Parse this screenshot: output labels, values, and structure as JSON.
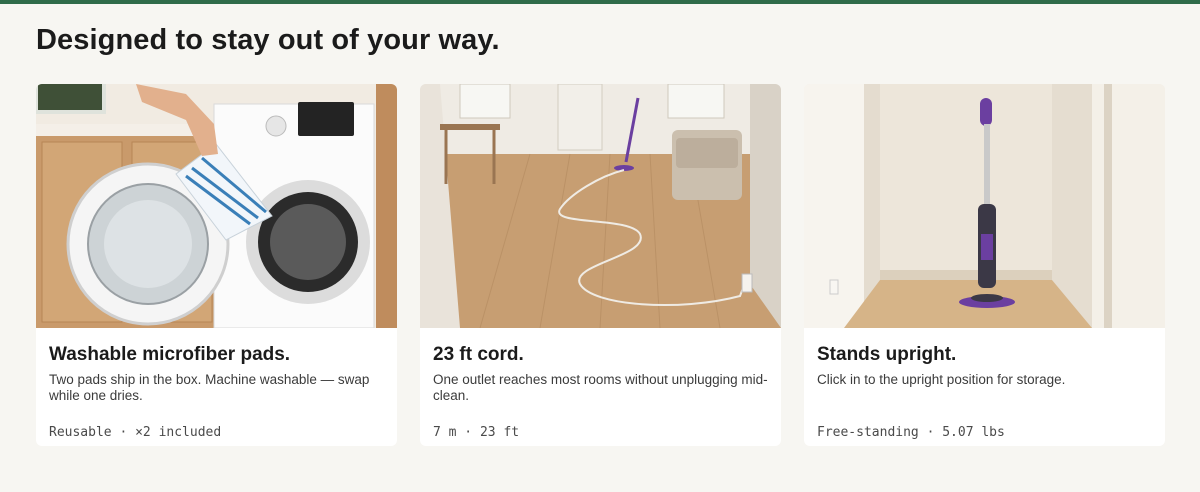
{
  "accent_color": "#2f6b4a",
  "section": {
    "headline": "Designed to stay out of your way."
  },
  "cards": [
    {
      "image_icon": "washing-machine-with-pad-photo",
      "title": "Washable microfiber pads.",
      "description": "Two pads ship in the box. Machine washable — swap while one dries.",
      "spec": "Reusable · ×2 included"
    },
    {
      "image_icon": "mop-with-long-cord-photo",
      "title": "23 ft cord.",
      "description": "One outlet reaches most rooms without unplugging mid-clean.",
      "spec": "7 m · 23 ft"
    },
    {
      "image_icon": "upright-steam-mop-photo",
      "title": "Stands upright.",
      "description": "Click in to the upright position for storage.",
      "spec": "Free-standing · 5.07 lbs"
    }
  ]
}
